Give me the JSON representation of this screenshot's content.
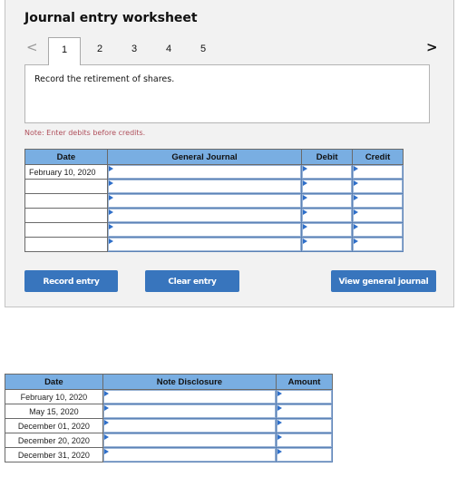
{
  "worksheet": {
    "title": "Journal entry worksheet",
    "prev_icon": "chevron-left-icon",
    "prev_glyph": "<",
    "next_icon": "chevron-right-icon",
    "next_glyph": ">",
    "tabs": [
      {
        "label": "1",
        "active": true
      },
      {
        "label": "2",
        "active": false
      },
      {
        "label": "3",
        "active": false
      },
      {
        "label": "4",
        "active": false
      },
      {
        "label": "5",
        "active": false
      }
    ],
    "instruction": "Record the retirement of shares.",
    "note": "Note: Enter debits before credits."
  },
  "journal_table": {
    "headers": {
      "date": "Date",
      "general_journal": "General Journal",
      "debit": "Debit",
      "credit": "Credit"
    },
    "rows": [
      {
        "date": "February 10, 2020",
        "account": "",
        "debit": "",
        "credit": ""
      },
      {
        "date": "",
        "account": "",
        "debit": "",
        "credit": ""
      },
      {
        "date": "",
        "account": "",
        "debit": "",
        "credit": ""
      },
      {
        "date": "",
        "account": "",
        "debit": "",
        "credit": ""
      },
      {
        "date": "",
        "account": "",
        "debit": "",
        "credit": ""
      },
      {
        "date": "",
        "account": "",
        "debit": "",
        "credit": ""
      }
    ]
  },
  "buttons": {
    "record": "Record entry",
    "clear": "Clear entry",
    "view": "View general journal"
  },
  "disclosure_table": {
    "headers": {
      "date": "Date",
      "note": "Note Disclosure",
      "amount": "Amount"
    },
    "rows": [
      {
        "date": "February 10, 2020",
        "note": "",
        "amount": ""
      },
      {
        "date": "May 15, 2020",
        "note": "",
        "amount": ""
      },
      {
        "date": "December 01, 2020",
        "note": "",
        "amount": ""
      },
      {
        "date": "December 20, 2020",
        "note": "",
        "amount": ""
      },
      {
        "date": "December 31, 2020",
        "note": "",
        "amount": ""
      }
    ]
  },
  "colors": {
    "header_blue": "#79aee2",
    "button_blue": "#3875bd",
    "note_red": "#b0505c",
    "panel_gray": "#f2f2f2"
  }
}
